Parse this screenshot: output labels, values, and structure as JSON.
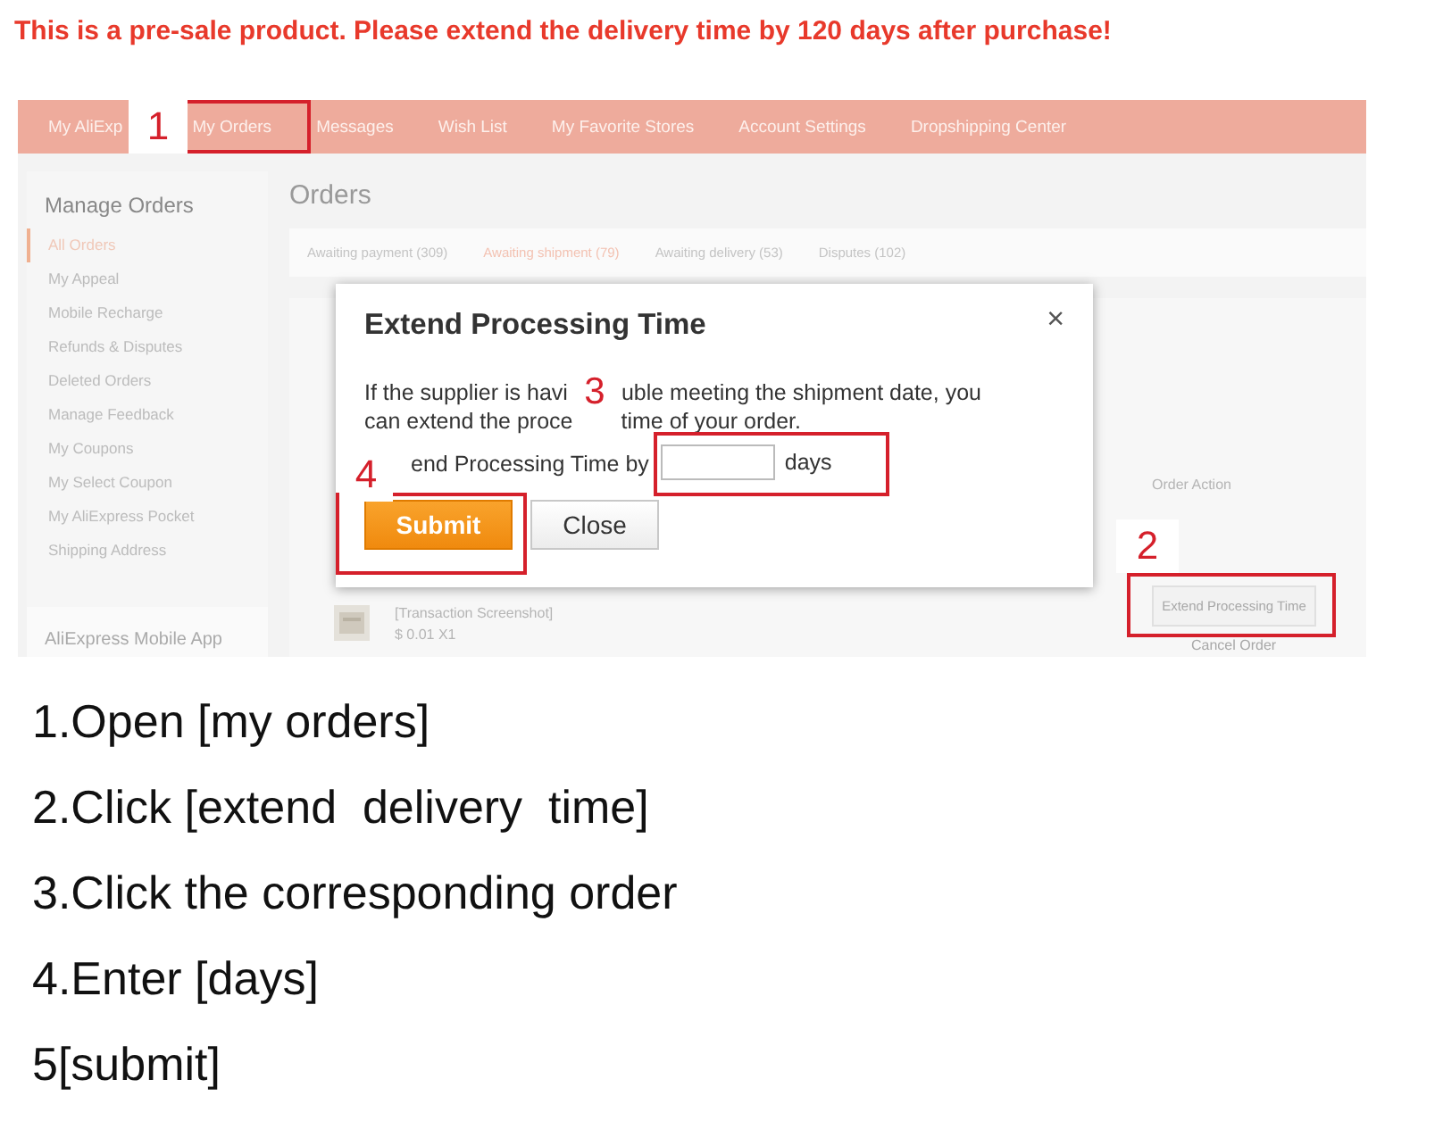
{
  "notice": "This is a pre-sale product. Please extend the delivery time by 120 days after purchase!",
  "nav": [
    "My AliExp",
    "My Orders",
    "Messages",
    "Wish List",
    "My Favorite Stores",
    "Account Settings",
    "Dropshipping Center"
  ],
  "sidebar": {
    "title": "Manage Orders",
    "items": [
      {
        "label": "All Orders",
        "selected": true
      },
      {
        "label": "My Appeal",
        "selected": false
      },
      {
        "label": "Mobile Recharge",
        "selected": false
      },
      {
        "label": "Refunds & Disputes",
        "selected": false
      },
      {
        "label": "Deleted Orders",
        "selected": false
      },
      {
        "label": "Manage Feedback",
        "selected": false
      },
      {
        "label": "My Coupons",
        "selected": false
      },
      {
        "label": "My Select Coupon",
        "selected": false
      },
      {
        "label": "My AliExpress Pocket",
        "selected": false
      },
      {
        "label": "Shipping Address",
        "selected": false
      }
    ],
    "app_title": "AliExpress Mobile App"
  },
  "orders": {
    "title": "Orders",
    "tabs": [
      {
        "label": "Awaiting payment (309)",
        "selected": false
      },
      {
        "label": "Awaiting shipment (79)",
        "selected": true
      },
      {
        "label": "Awaiting delivery (53)",
        "selected": false
      },
      {
        "label": "Disputes (102)",
        "selected": false
      }
    ],
    "product": "[Transaction Screenshot]",
    "price": "$ 0.01 X1",
    "action_header": "Order Action",
    "action_button": "Extend Processing Time",
    "cancel": "Cancel Order"
  },
  "dialog": {
    "title": "Extend Processing Time",
    "close": "×",
    "lines": [
      [
        "If the supplier is havi",
        "uble meeting the shipment date, you"
      ],
      [
        "can extend the proce",
        "time of your order."
      ]
    ],
    "prompt": "end Processing Time by",
    "unit": "days",
    "buttons": [
      {
        "label": "Submit",
        "kind": "primary"
      },
      {
        "label": "Close",
        "kind": "secondary"
      }
    ]
  },
  "annotations": [
    "1",
    "2",
    "3",
    "4"
  ],
  "steps": [
    "1.Open [my orders]",
    "2.Click [extend  delivery  time]",
    "3.Click the corresponding order",
    "4.Enter [days]",
    "5[submit]"
  ]
}
